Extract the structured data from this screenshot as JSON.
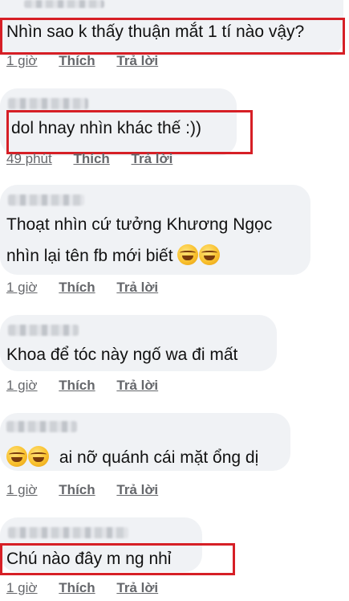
{
  "comments": [
    {
      "text": "Nhìn sao k thấy thuận mắt 1 tí nào vậy?",
      "time": "1 giờ",
      "like": "Thích",
      "reply": "Trả lời",
      "highlighted": true
    },
    {
      "text": "dol hnay nhìn khác thế :))",
      "time": "49 phút",
      "like": "Thích",
      "reply": "Trả lời",
      "highlighted": true
    },
    {
      "line1": "Thoạt nhìn cứ tưởng Khương Ngọc",
      "line2": "nhìn lại tên fb mới biết",
      "emoji": "rolling-on-floor-laughing",
      "time": "1 giờ",
      "like": "Thích",
      "reply": "Trả lời",
      "highlighted": false
    },
    {
      "text": "Khoa để tóc này ngố wa đi mất",
      "time": "1 giờ",
      "like": "Thích",
      "reply": "Trả lời",
      "highlighted": false
    },
    {
      "text": "ai nỡ quánh cái mặt ổng dị",
      "emoji": "rolling-on-floor-laughing",
      "time": "1 giờ",
      "like": "Thích",
      "reply": "Trả lời",
      "highlighted": false
    },
    {
      "text": "Chú nào đây m ng nhỉ",
      "time": "1 giờ",
      "like": "Thích",
      "reply": "Trả lời",
      "highlighted": true
    }
  ],
  "highlight_color": "#d61f26",
  "bubble_color": "#f0f2f5"
}
